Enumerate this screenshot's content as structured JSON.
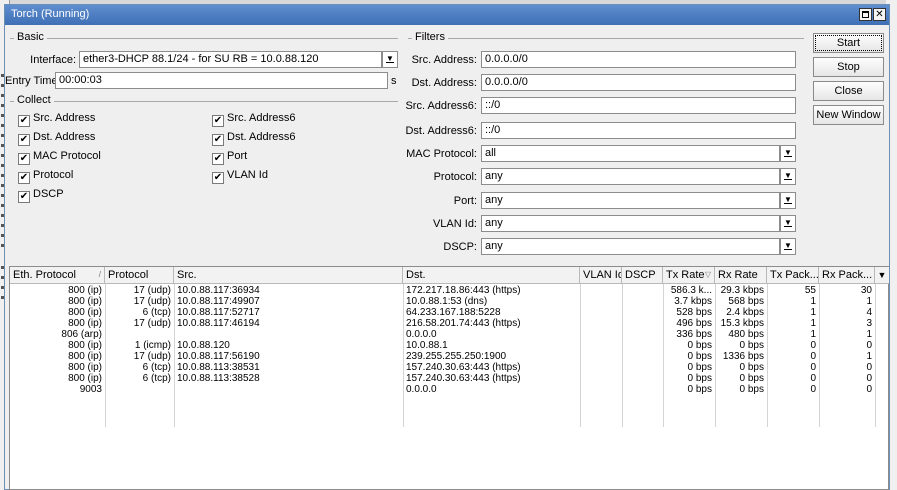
{
  "window": {
    "title": "Torch (Running)"
  },
  "basic": {
    "legend": "Basic",
    "interface_label": "Interface:",
    "interface_value": "ether3-DHCP 88.1/24 - for SU RB = 10.0.88.120",
    "entry_timeout_label": "Entry Timeout:",
    "entry_timeout_value": "00:00:03",
    "entry_timeout_unit": "s"
  },
  "collect": {
    "legend": "Collect",
    "options": [
      {
        "label": "Src. Address",
        "checked": true
      },
      {
        "label": "Dst. Address",
        "checked": true
      },
      {
        "label": "MAC Protocol",
        "checked": true
      },
      {
        "label": "Protocol",
        "checked": true
      },
      {
        "label": "DSCP",
        "checked": true
      },
      {
        "label": "Src. Address6",
        "checked": true
      },
      {
        "label": "Dst. Address6",
        "checked": true
      },
      {
        "label": "Port",
        "checked": true
      },
      {
        "label": "VLAN Id",
        "checked": true
      }
    ]
  },
  "filters": {
    "legend": "Filters",
    "fields": [
      {
        "label": "Src. Address:",
        "value": "0.0.0.0/0"
      },
      {
        "label": "Dst. Address:",
        "value": "0.0.0.0/0"
      },
      {
        "label": "Src. Address6:",
        "value": "::/0"
      },
      {
        "label": "Dst. Address6:",
        "value": "::/0"
      },
      {
        "label": "MAC Protocol:",
        "value": "all"
      },
      {
        "label": "Protocol:",
        "value": "any"
      },
      {
        "label": "Port:",
        "value": "any"
      },
      {
        "label": "VLAN Id:",
        "value": "any"
      },
      {
        "label": "DSCP:",
        "value": "any"
      }
    ]
  },
  "buttons": {
    "start": "Start",
    "stop": "Stop",
    "close": "Close",
    "new_window": "New Window"
  },
  "table": {
    "columns": [
      "Eth. Protocol",
      "Protocol",
      "Src.",
      "Dst.",
      "VLAN Id",
      "DSCP",
      "Tx Rate",
      "Rx Rate",
      "Tx Pack...",
      "Rx Pack..."
    ],
    "sort_glyph": "▽",
    "rows": [
      [
        "800 (ip)",
        "17 (udp)",
        "10.0.88.117:36934",
        "172.217.18.86:443 (https)",
        "",
        "",
        "586.3 k...",
        "29.3 kbps",
        "55",
        "30"
      ],
      [
        "800 (ip)",
        "17 (udp)",
        "10.0.88.117:49907",
        "10.0.88.1:53 (dns)",
        "",
        "",
        "3.7 kbps",
        "568 bps",
        "1",
        "1"
      ],
      [
        "800 (ip)",
        "6 (tcp)",
        "10.0.88.117:52717",
        "64.233.167.188:5228",
        "",
        "",
        "528 bps",
        "2.4 kbps",
        "1",
        "4"
      ],
      [
        "800 (ip)",
        "17 (udp)",
        "10.0.88.117:46194",
        "216.58.201.74:443 (https)",
        "",
        "",
        "496 bps",
        "15.3 kbps",
        "1",
        "3"
      ],
      [
        "806 (arp)",
        "",
        "",
        "0.0.0.0",
        "",
        "",
        "336 bps",
        "480 bps",
        "1",
        "1"
      ],
      [
        "800 (ip)",
        "1 (icmp)",
        "10.0.88.120",
        "10.0.88.1",
        "",
        "",
        "0 bps",
        "0 bps",
        "0",
        "0"
      ],
      [
        "800 (ip)",
        "17 (udp)",
        "10.0.88.117:56190",
        "239.255.255.250:1900",
        "",
        "",
        "0 bps",
        "1336 bps",
        "0",
        "1"
      ],
      [
        "800 (ip)",
        "6 (tcp)",
        "10.0.88.113:38531",
        "157.240.30.63:443 (https)",
        "",
        "",
        "0 bps",
        "0 bps",
        "0",
        "0"
      ],
      [
        "800 (ip)",
        "6 (tcp)",
        "10.0.88.113:38528",
        "157.240.30.63:443 (https)",
        "",
        "",
        "0 bps",
        "0 bps",
        "0",
        "0"
      ],
      [
        "9003",
        "",
        "",
        "0.0.0.0",
        "",
        "",
        "0 bps",
        "0 bps",
        "0",
        "0"
      ]
    ]
  }
}
